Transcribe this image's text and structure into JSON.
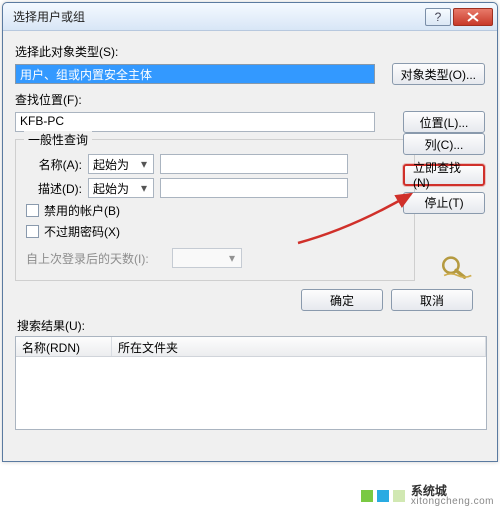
{
  "window": {
    "title": "选择用户或组"
  },
  "section1": {
    "object_type_label": "选择此对象类型(S):",
    "object_type_value": "用户、组或内置安全主体",
    "object_type_btn": "对象类型(O)...",
    "location_label": "查找位置(F):",
    "location_value": "KFB-PC",
    "location_btn": "位置(L)..."
  },
  "query": {
    "legend": "一般性查询",
    "name_label": "名称(A):",
    "name_op": "起始为",
    "desc_label": "描述(D):",
    "desc_op": "起始为",
    "chk_disabled": "禁用的帐户(B)",
    "chk_noexpire": "不过期密码(X)",
    "days_label": "自上次登录后的天数(I):"
  },
  "side": {
    "columns_btn": "列(C)...",
    "find_now_btn": "立即查找(N)",
    "stop_btn": "停止(T)"
  },
  "dialog": {
    "ok": "确定",
    "cancel": "取消"
  },
  "results": {
    "label": "搜索结果(U):",
    "col1": "名称(RDN)",
    "col2": "所在文件夹"
  },
  "watermark": {
    "brand": "系统城",
    "url": "xitongcheng.com"
  }
}
